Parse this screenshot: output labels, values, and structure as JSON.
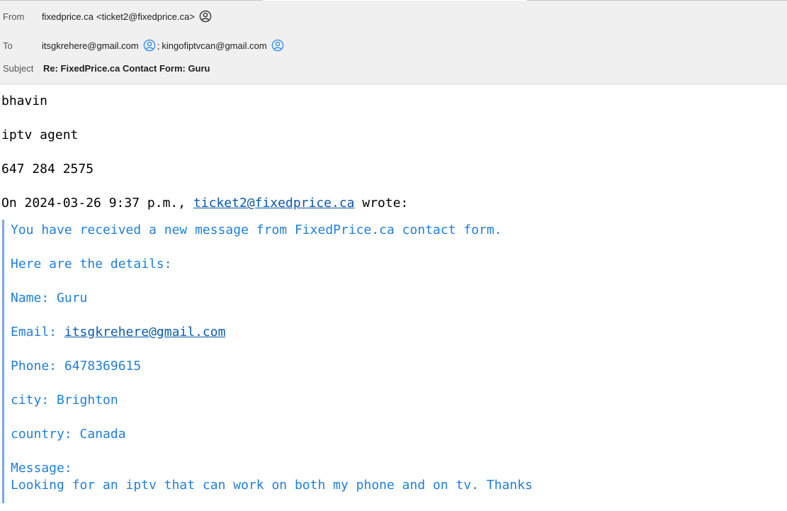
{
  "header": {
    "from": {
      "label": "From",
      "name": "fixedprice.ca",
      "address": "<ticket2@fixedprice.ca>"
    },
    "to": {
      "label": "To",
      "recipients": [
        "itsgkrehere@gmail.com",
        "kingofiptvcan@gmail.com"
      ],
      "separator": ";"
    },
    "subject": {
      "label": "Subject",
      "value": "Re: FixedPrice.ca Contact Form: Guru"
    }
  },
  "body": {
    "reply_lines": [
      "bhavin",
      "iptv agent",
      "647 284 2575"
    ],
    "attribution": {
      "prefix": "On 2024-03-26 9:37 p.m., ",
      "email": "ticket2@fixedprice.ca",
      "suffix": " wrote:"
    },
    "quoted": {
      "intro": "You have received a new message from FixedPrice.ca contact form.",
      "details_heading": "Here are the details:",
      "name": "Name: Guru",
      "email_label": "Email: ",
      "email_value": "itsgkrehere@gmail.com",
      "phone": "Phone: 6478369615",
      "city": "city: Brighton",
      "country": "country: Canada",
      "message_label": "Message:",
      "message_text": "Looking for an iptv that can work on both my phone and on tv. Thanks"
    }
  },
  "colors": {
    "header_bg": "#f0f0f0",
    "quote_text": "#1f7fd8",
    "quote_bar": "#7aa7e0",
    "link": "#0b57a8",
    "contact_icon": "#3a8ee6"
  },
  "icons": {
    "sender": "account-circle-icon",
    "recipient": "contact-icon"
  }
}
